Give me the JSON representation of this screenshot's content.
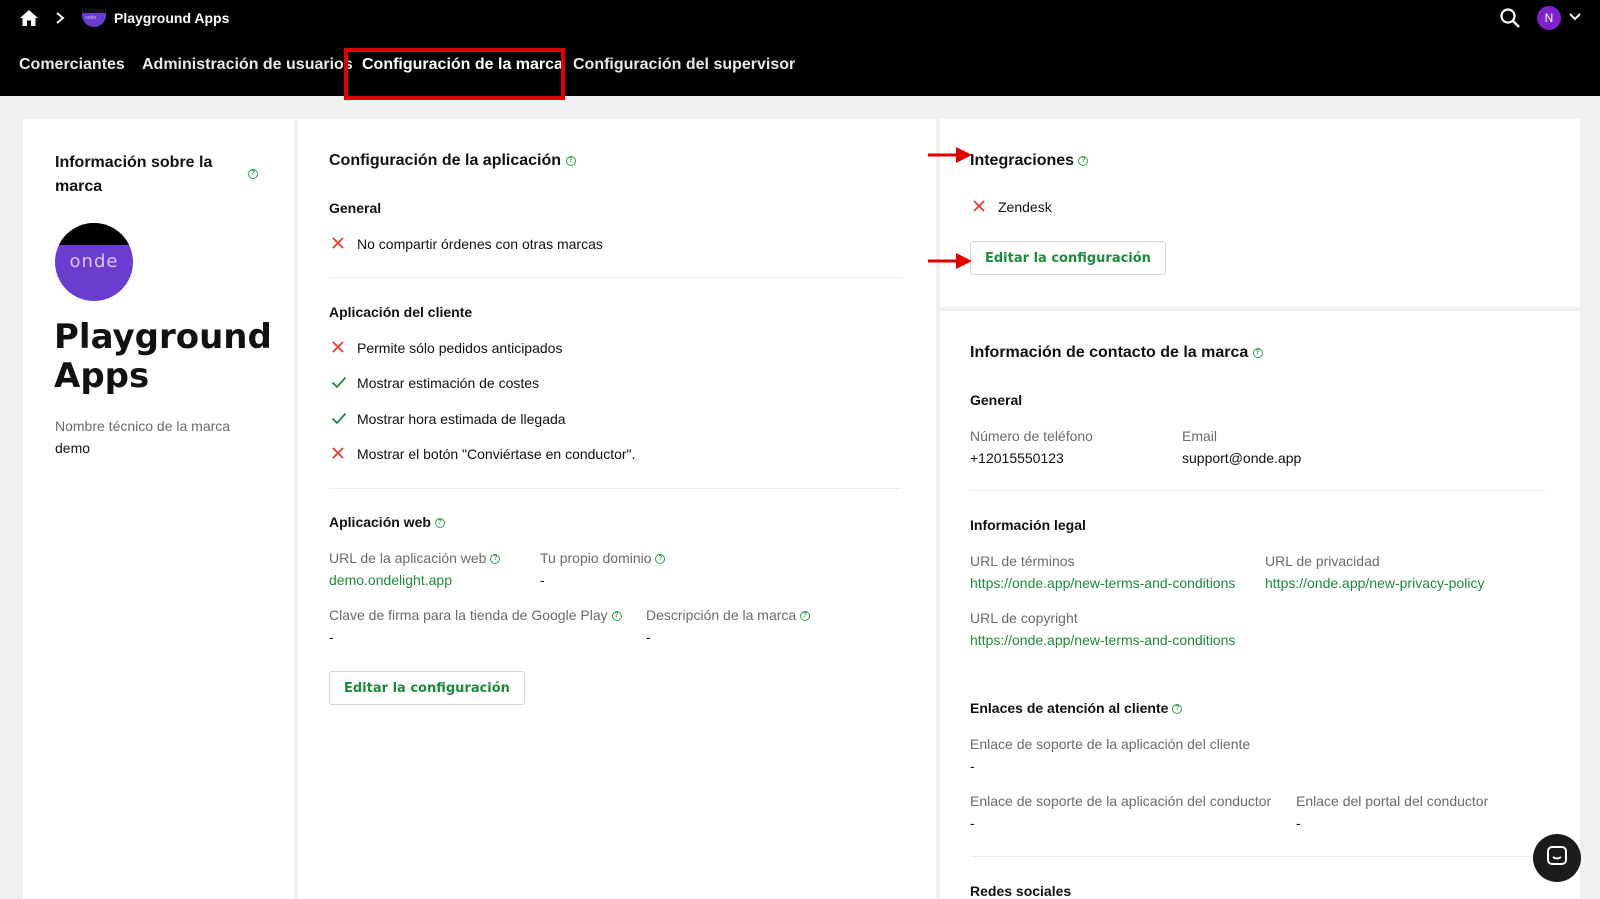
{
  "topbar": {
    "breadcrumb_app": "Playground Apps",
    "avatar_initial": "N",
    "logo_text": "onde"
  },
  "nav": {
    "tabs": [
      "Comerciantes",
      "Administración de usuarios",
      "Configuración de la marca",
      "Configuración del supervisor"
    ],
    "active_index": 2
  },
  "brand_panel": {
    "title": "Información sobre la marca",
    "logo_text": "onde",
    "brand_name": "Playground Apps",
    "tech_name_label": "Nombre técnico de la marca",
    "tech_name_value": "demo"
  },
  "app_config": {
    "title": "Configuración de la aplicación",
    "general_heading": "General",
    "general_items": [
      {
        "label": "No compartir órdenes con otras marcas",
        "enabled": false
      }
    ],
    "client_heading": "Aplicación del cliente",
    "client_items": [
      {
        "label": "Permite sólo pedidos anticipados",
        "enabled": false
      },
      {
        "label": "Mostrar estimación de costes",
        "enabled": true
      },
      {
        "label": "Mostrar hora estimada de llegada",
        "enabled": true
      },
      {
        "label": "Mostrar el botón \"Conviértase en conductor\".",
        "enabled": false
      }
    ],
    "web_heading": "Aplicación web",
    "web_url_label": "URL de la aplicación web",
    "web_url_value": "demo.ondelight.app",
    "domain_label": "Tu propio dominio",
    "domain_value": "-",
    "google_key_label": "Clave de firma para la tienda de Google Play",
    "google_key_value": "-",
    "brand_desc_label": "Descripción de la marca",
    "brand_desc_value": "-",
    "edit_button": "Editar la configuración"
  },
  "integrations": {
    "title": "Integraciones",
    "items": [
      {
        "label": "Zendesk",
        "enabled": false
      }
    ],
    "edit_button": "Editar la configuración"
  },
  "contact": {
    "title": "Información de contacto de la marca",
    "general_heading": "General",
    "phone_label": "Número de teléfono",
    "phone_value": "+12015550123",
    "email_label": "Email",
    "email_value": "support@onde.app",
    "legal_heading": "Información legal",
    "terms_label": "URL de términos",
    "terms_value": "https://onde.app/new-terms-and-conditions",
    "privacy_label": "URL de privacidad",
    "privacy_value": "https://onde.app/new-privacy-policy",
    "copyright_label": "URL de copyright",
    "copyright_value": "https://onde.app/new-terms-and-conditions",
    "support_heading": "Enlaces de atención al cliente",
    "client_support_label": "Enlace de soporte de la aplicación del cliente",
    "client_support_value": "-",
    "driver_support_label": "Enlace de soporte de la aplicación del conductor",
    "driver_support_value": "-",
    "driver_portal_label": "Enlace del portal del conductor",
    "driver_portal_value": "-",
    "social_heading": "Redes sociales"
  },
  "colors": {
    "accent_green": "#1e8a3c",
    "cross_red": "#e53935",
    "highlight_red": "#e00000",
    "brand_purple": "#6a3ccf"
  }
}
